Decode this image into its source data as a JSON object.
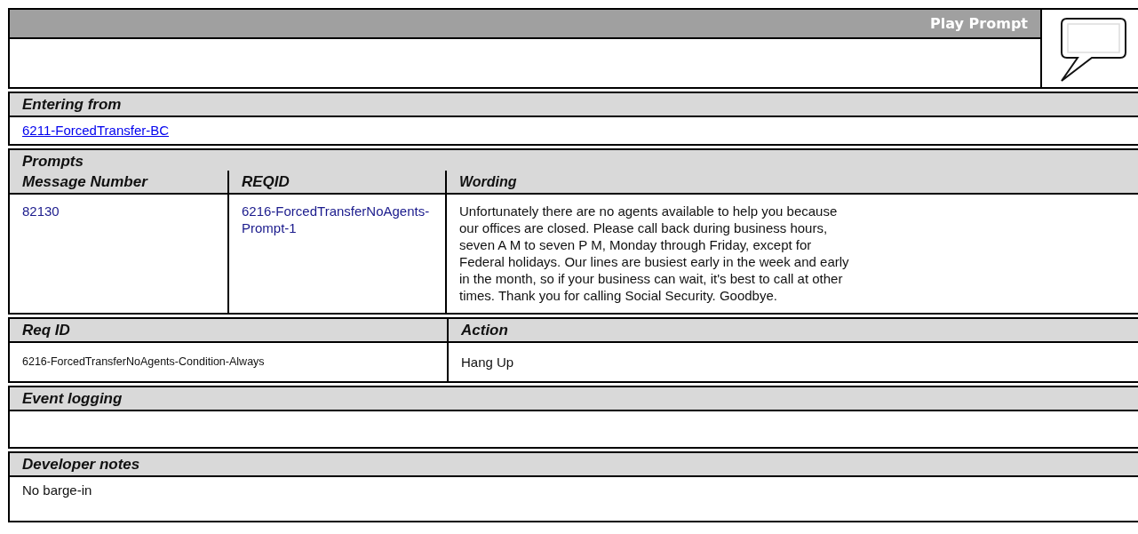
{
  "header": {
    "title": "Play Prompt"
  },
  "entering_from": {
    "title": "Entering from",
    "links": [
      "6211-ForcedTransfer-BC"
    ]
  },
  "prompts": {
    "title": "Prompts",
    "columns": [
      "Message Number",
      "REQID",
      "Wording"
    ],
    "rows": [
      {
        "message_number": "82130",
        "reqid": "6216-ForcedTransferNoAgents-Prompt-1",
        "wording": "Unfortunately there are no agents available to help you because our offices are closed. Please call back during business hours, seven A M to seven P M, Monday through Friday, except for Federal holidays. Our lines are busiest early in the week and early in the month, so if your business can wait, it's best to call at other times. Thank you for calling Social Security. Goodbye."
      }
    ]
  },
  "transitions": {
    "columns": [
      "Req ID",
      "Action"
    ],
    "rows": [
      {
        "req_id": "6216-ForcedTransferNoAgents-Condition-Always",
        "action": "Hang Up"
      }
    ]
  },
  "event_logging": {
    "title": "Event logging"
  },
  "developer_notes": {
    "title": "Developer notes",
    "text": "No barge-in"
  }
}
